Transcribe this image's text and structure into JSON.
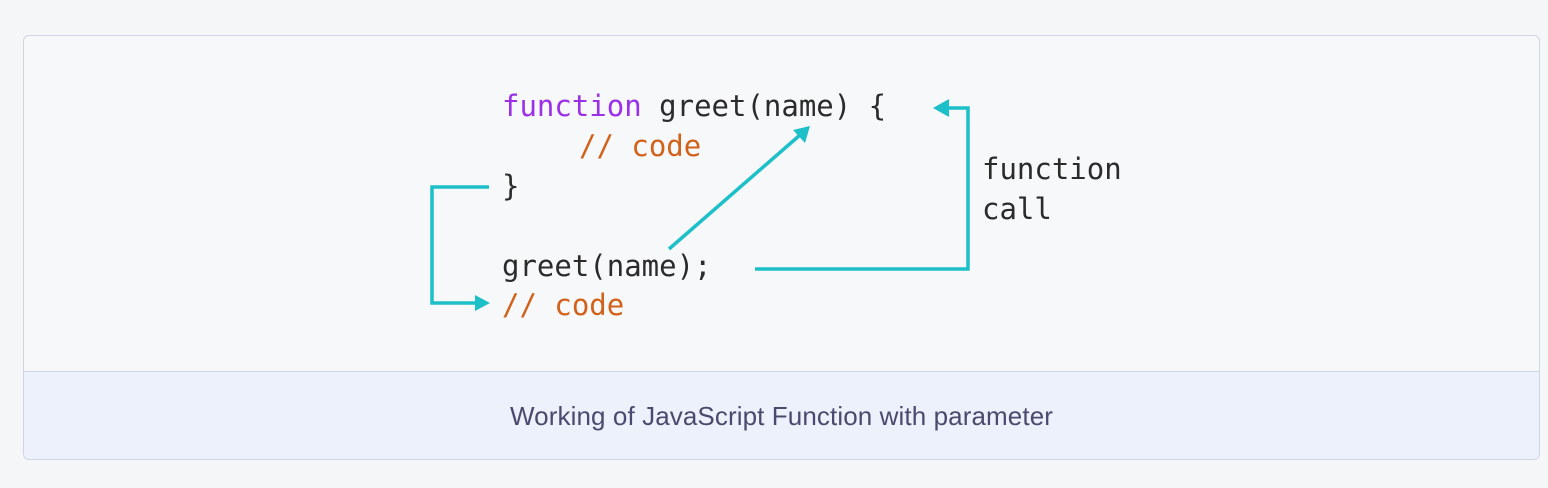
{
  "code": {
    "line1_keyword": "function",
    "line1_rest": " greet(name) {",
    "line2_comment": "// code",
    "line3": "}",
    "line4": "greet(name);",
    "line5_comment": "// code"
  },
  "annotation": {
    "line1": "function",
    "line2": "call"
  },
  "caption": "Working of JavaScript Function with parameter",
  "colors": {
    "keyword": "#9b30e6",
    "comment": "#d2621a",
    "arrow": "#1dbfc8",
    "caption_text": "#4b4a6e",
    "caption_bg": "#edf1fb"
  }
}
